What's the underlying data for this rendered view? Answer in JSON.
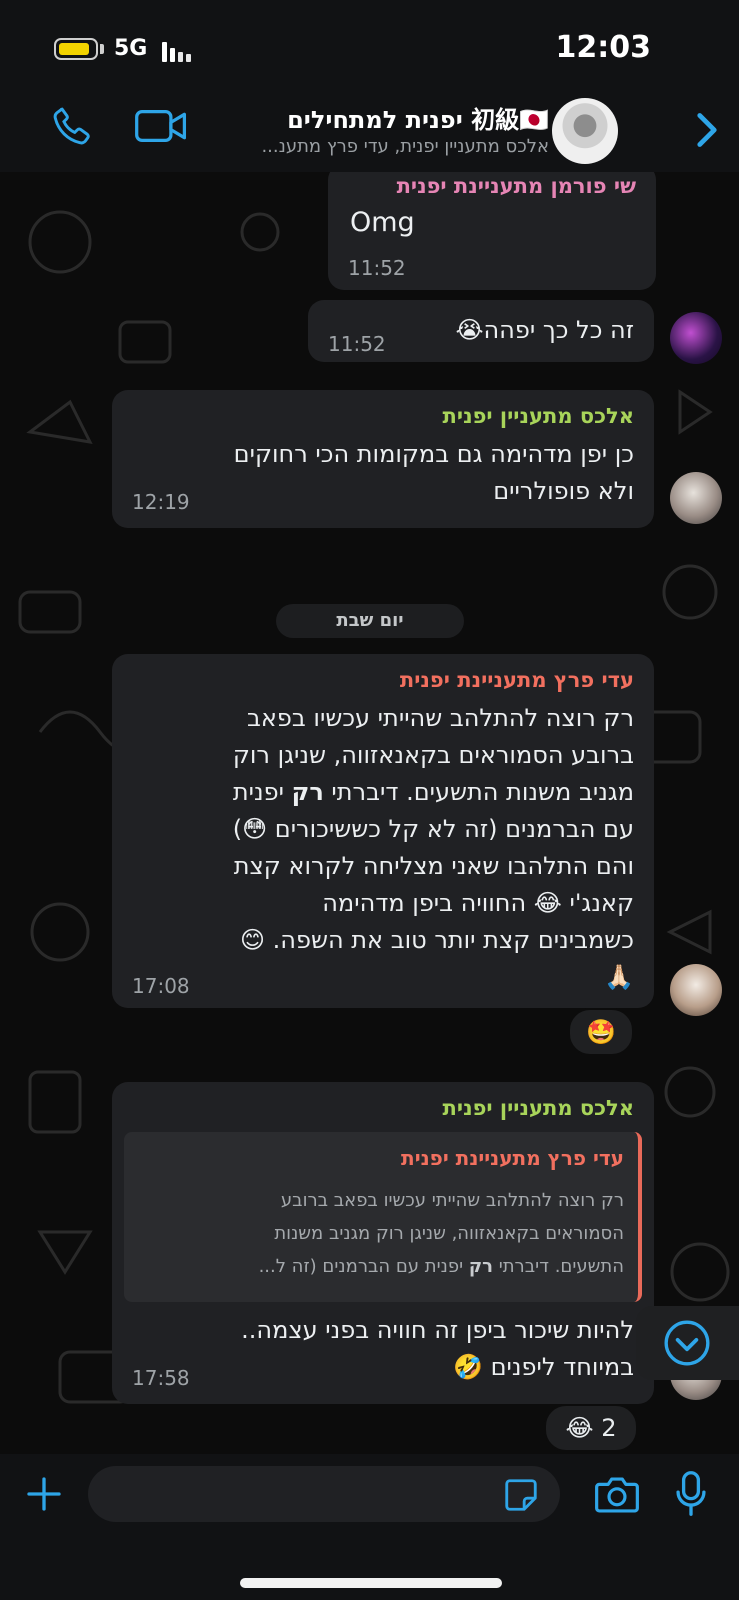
{
  "status_bar": {
    "network": "5G",
    "time": "12:03"
  },
  "header": {
    "title": "初級🇯🇵 יפנית למתחילים",
    "subtitle": "אלכס מתעניין יפנית, עדי פרץ מתענ...",
    "icons": [
      "phone-icon",
      "video-icon",
      "chevron-right-icon"
    ]
  },
  "messages": [
    {
      "sender": "שי פורמן מתעניינת יפנית",
      "sender_color": "#e685b5",
      "text": "Omg",
      "time": "11:52"
    },
    {
      "sender": "",
      "text": "זה כל כך יפהה😭",
      "time": "11:52"
    },
    {
      "sender": "אלכס מתעניין יפנית",
      "sender_color": "#a8d45a",
      "lines": [
        "כן יפן מדהימה גם במקומות הכי רחוקים",
        "ולא פופולריים"
      ],
      "time": "12:19"
    },
    {
      "sender": "עדי פרץ מתעניינת יפנית",
      "sender_color": "#f2705f",
      "lines": [
        "רק רוצה להתלהב שהייתי עכשיו בפאב",
        "ברובע הסמוראים בקאנאזווה, שניגן רוק",
        "מגניב משנות התשעים. דיברתי",
        "רק",
        "יפנית",
        "עם הברמנים (זה לא קל כששיכורים 😳)",
        "והם התלהבו שאני מצליחה לקרוא קצת",
        "קאנג'י 😂 החוויה ביפן מדהימה",
        "כשמבינים קצת יותר טוב את השפה. 😊",
        "🙏🏻"
      ],
      "time": "17:08",
      "reaction": "🤩"
    },
    {
      "sender": "אלכס מתעניין יפנית",
      "sender_color": "#a8d45a",
      "quote": {
        "sender": "עדי פרץ מתעניינת יפנית",
        "lines": [
          "רק רוצה להתלהב שהייתי עכשיו בפאב ברובע",
          "הסמוראים בקאנאזווה, שניגן רוק מגניב משנות",
          "התשעים. דיברתי",
          "רק",
          "יפנית עם הברמנים (זה ל..."
        ]
      },
      "lines": [
        "להיות שיכור ביפן זה חוויה בפני עצמה..",
        "במיוחד ליפנים 🤣"
      ],
      "time": "17:58",
      "reaction": "😂 2"
    }
  ],
  "date_separator": "יום שבת",
  "input": {
    "placeholder": ""
  }
}
